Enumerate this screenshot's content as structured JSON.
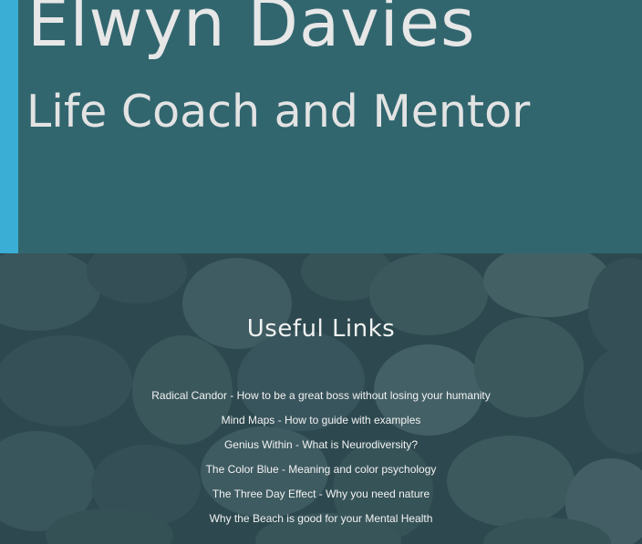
{
  "hero": {
    "name": "Elwyn Davies",
    "tagline": "Life Coach and Mentor"
  },
  "links_section": {
    "heading": "Useful Links",
    "links": [
      {
        "label": "Radical Candor - How to be a great boss without losing your humanity"
      },
      {
        "label": "Mind Maps - How to guide with examples"
      },
      {
        "label": "Genius Within - What is Neurodiversity?"
      },
      {
        "label": "The Color Blue - Meaning and color psychology"
      },
      {
        "label": "The Three Day Effect - Why you need nature"
      },
      {
        "label": "Why the Beach is good for your Mental Health"
      }
    ]
  },
  "colors": {
    "hero_background": "#32666f",
    "accent_bar": "#3aaed4",
    "section_overlay": "#224850",
    "text": "#f1f1f1"
  }
}
